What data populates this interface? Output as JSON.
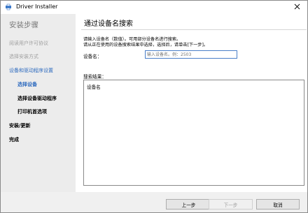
{
  "window": {
    "title": "Driver Installer",
    "icon": "driver-installer-app-icon",
    "close_icon": "close-icon"
  },
  "sidebar": {
    "heading": "安装步骤",
    "steps": [
      {
        "label": "阅读用户许可协议",
        "state": "done"
      },
      {
        "label": "选择安装方式",
        "state": "done"
      },
      {
        "label": "设备和驱动程序设置",
        "state": "current-group"
      },
      {
        "label": "选择设备",
        "state": "current"
      },
      {
        "label": "选择设备驱动程序",
        "state": "pending"
      },
      {
        "label": "打印机首选项",
        "state": "pending"
      },
      {
        "label": "安装/更新",
        "state": "pending"
      },
      {
        "label": "完成",
        "state": "pending"
      }
    ]
  },
  "main": {
    "title": "通过设备名搜索",
    "instructions": [
      "请输入设备名（数值）。可用部分设备名进行搜索。",
      "请从正在使用的设备搜索结果中选择，选择后，请单击[下一步]。"
    ],
    "device_name_label": "设备名：",
    "device_name_value": "",
    "device_name_placeholder": "输入设备名。例：2503",
    "results_label": "搜索结果：",
    "results_column_header": "设备名",
    "results": []
  },
  "footer": {
    "back_label": "上一步",
    "next_label": "下一步",
    "next_enabled": false,
    "cancel_label": "取消"
  },
  "colors": {
    "accent": "#2e6bbf",
    "done_step": "#a0a0a0",
    "sidebar_bg": "#ececec",
    "input_border": "#4a7fc8"
  }
}
